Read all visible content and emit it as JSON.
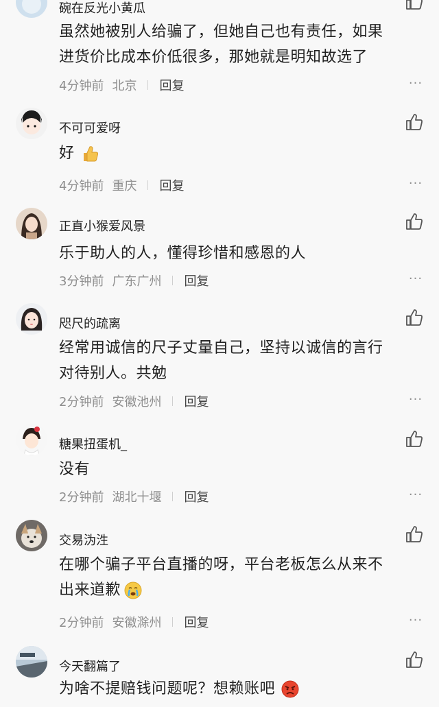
{
  "comments": [
    {
      "username": "碗在反光小黄瓜",
      "lines": [
        "虽然她被别人给骗了，但她自己也有责任，如果",
        "进货价比成本价低很多，那她就是明知故选了"
      ],
      "time": "4分钟前",
      "location": "北京",
      "reply": "回复",
      "more": "···"
    },
    {
      "username": "不可可爱呀",
      "lines": [
        "好"
      ],
      "emoji": "thumbs-up-emoji",
      "time": "4分钟前",
      "location": "重庆",
      "reply": "回复",
      "more": "···"
    },
    {
      "username": "正直小猴爱风景",
      "lines": [
        "乐于助人的人，懂得珍惜和感恩的人"
      ],
      "time": "3分钟前",
      "location": "广东广州",
      "reply": "回复",
      "more": "···"
    },
    {
      "username": "咫尺的疏离",
      "lines": [
        "经常用诚信的尺子丈量自己，坚持以诚信的言行",
        "对待别人。共勉"
      ],
      "time": "2分钟前",
      "location": "安徽池州",
      "reply": "回复",
      "more": "···"
    },
    {
      "username": "糖果扭蛋机_",
      "lines": [
        "没有"
      ],
      "time": "2分钟前",
      "location": "湖北十堰",
      "reply": "回复",
      "more": "···"
    },
    {
      "username": "交易沩泩",
      "lines": [
        "在哪个骗子平台直播的呀，平台老板怎么从来不",
        "出来道歉"
      ],
      "emoji": "crying-face-emoji",
      "time": "2分钟前",
      "location": "安徽滁州",
      "reply": "回复",
      "more": "···"
    },
    {
      "username": "今天翻篇了",
      "lines": [
        "为啥不提赔钱问题呢？想赖账吧"
      ],
      "emoji": "angry-face-emoji",
      "time": "",
      "location": "",
      "reply": "",
      "more": ""
    }
  ]
}
